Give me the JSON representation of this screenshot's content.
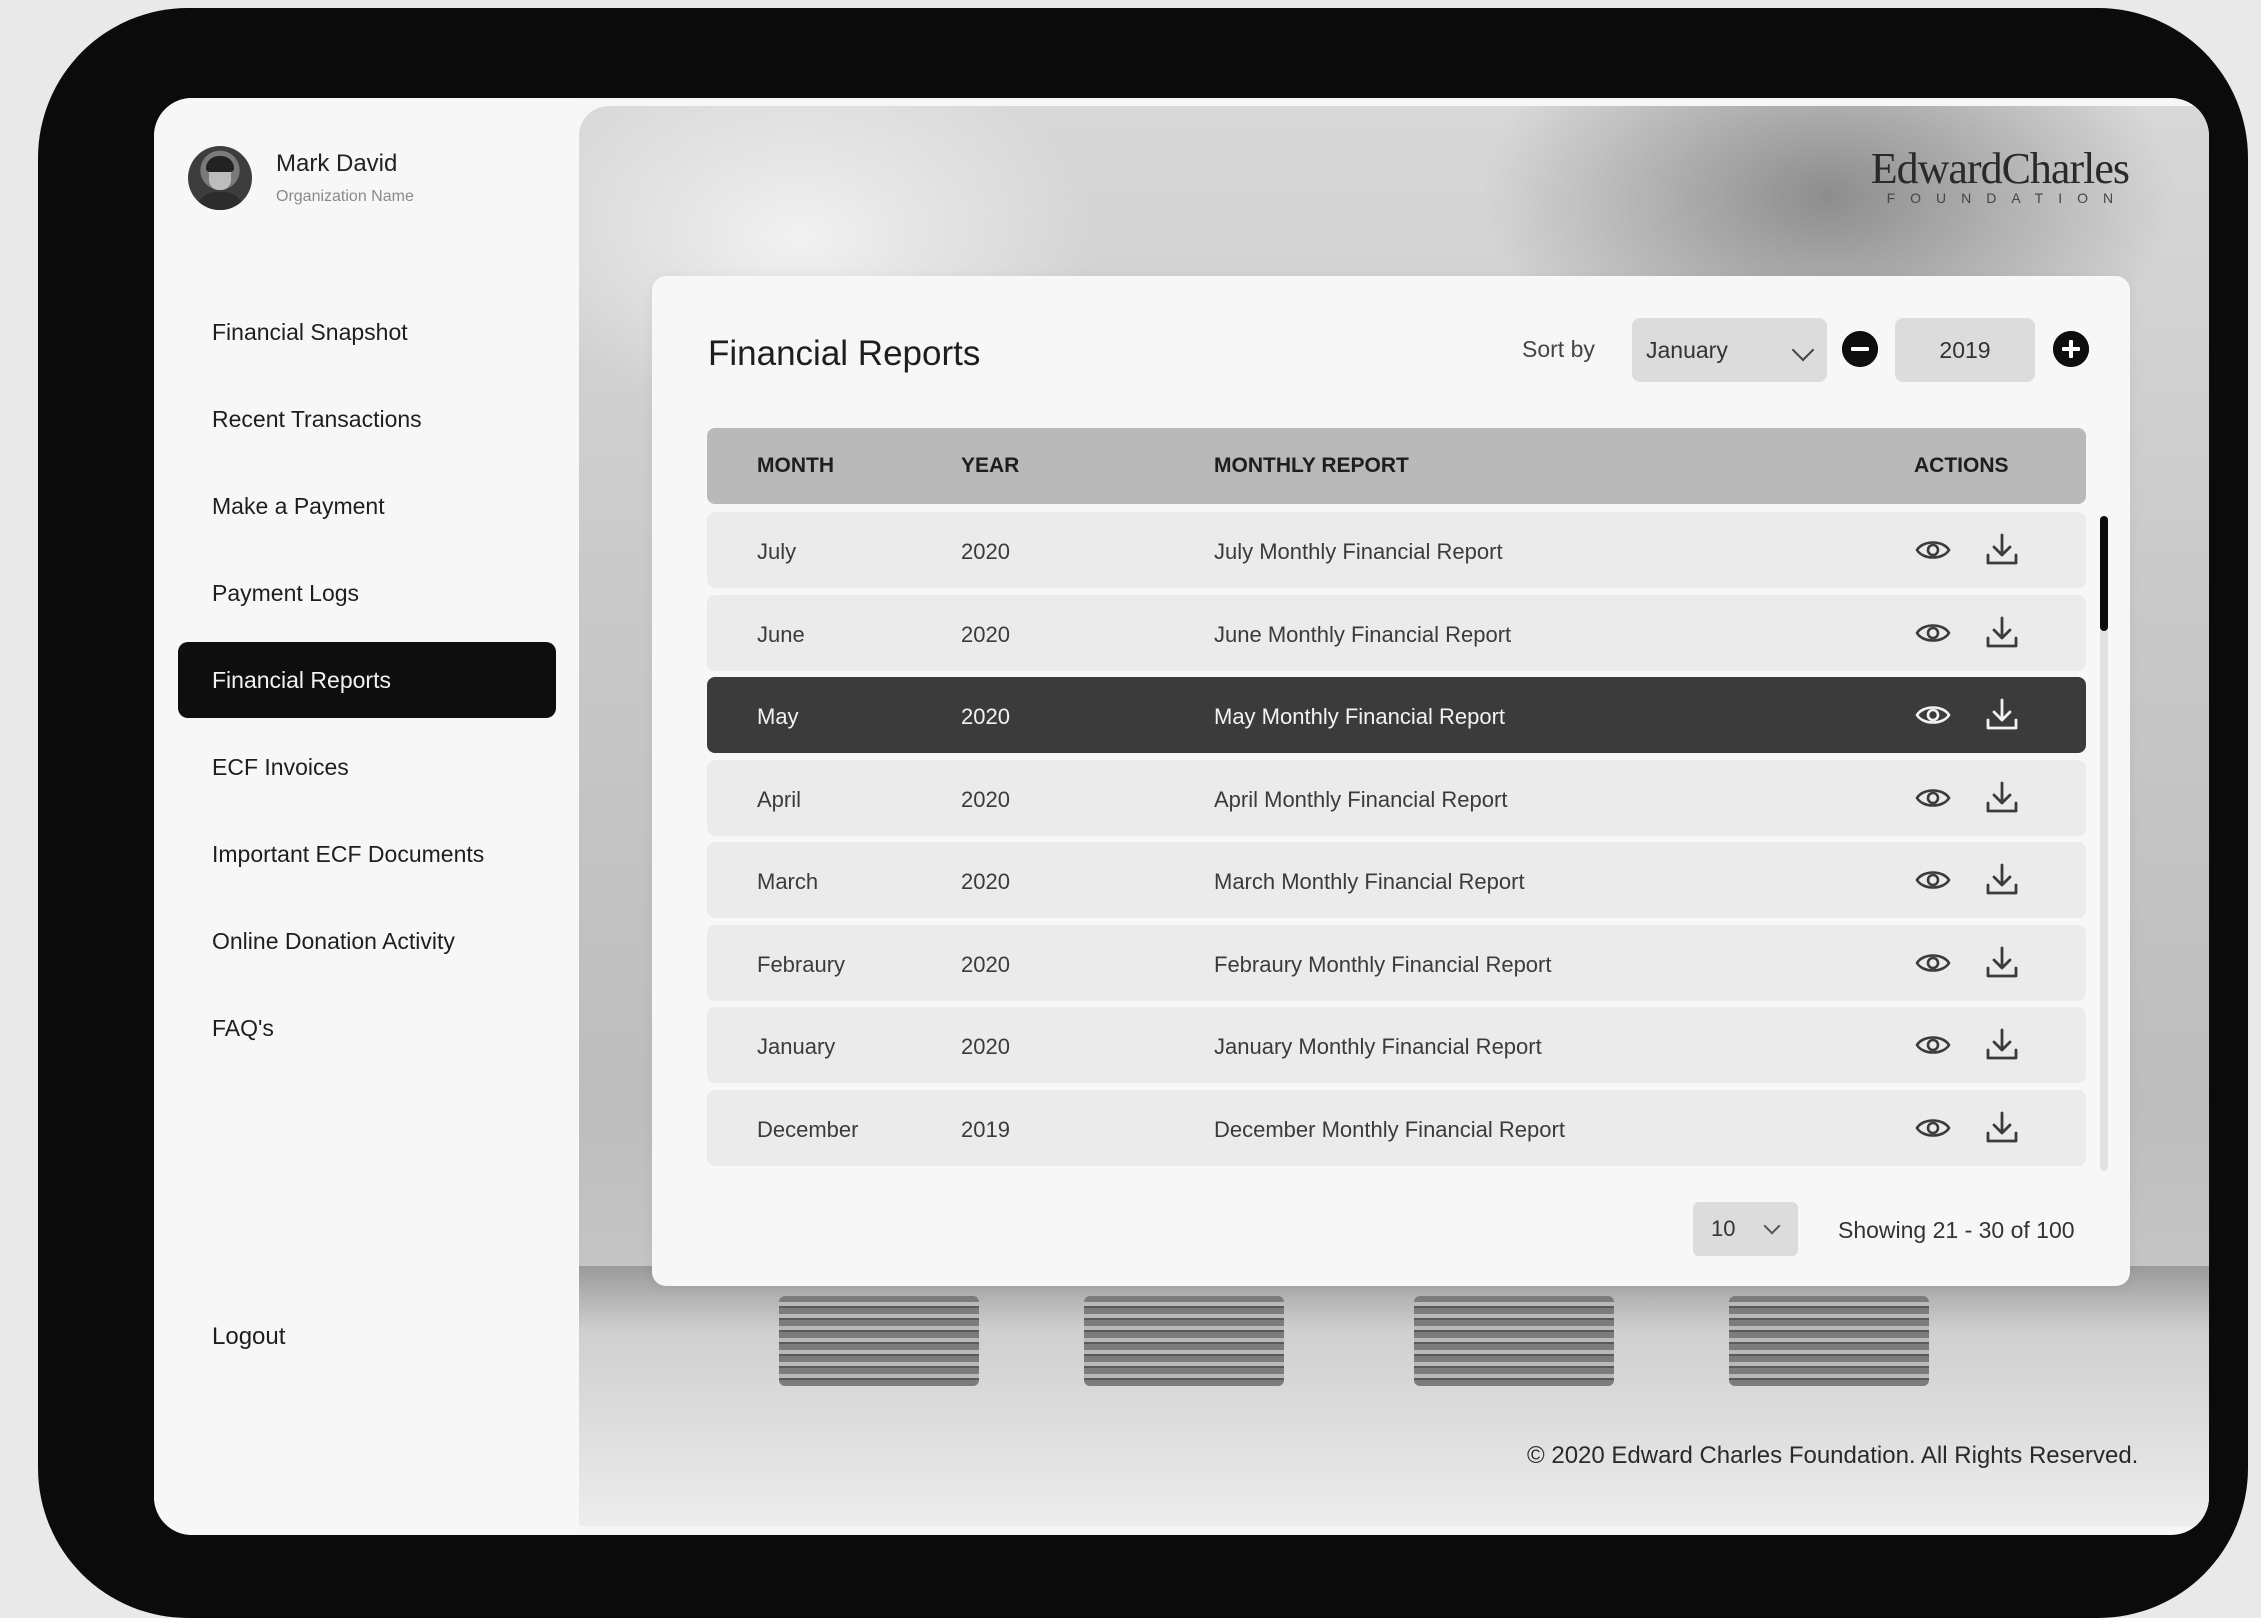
{
  "user": {
    "name": "Mark David",
    "organization": "Organization Name"
  },
  "sidebar": {
    "items": [
      {
        "label": "Financial Snapshot",
        "active": false
      },
      {
        "label": "Recent Transactions",
        "active": false
      },
      {
        "label": "Make a Payment",
        "active": false
      },
      {
        "label": "Payment Logs",
        "active": false
      },
      {
        "label": "Financial Reports",
        "active": true
      },
      {
        "label": "ECF Invoices",
        "active": false
      },
      {
        "label": "Important ECF Documents",
        "active": false
      },
      {
        "label": "Online Donation Activity",
        "active": false
      },
      {
        "label": "FAQ's",
        "active": false
      }
    ],
    "logout_label": "Logout"
  },
  "brand": {
    "name": "EdwardCharles",
    "sub": "FOUNDATION"
  },
  "page": {
    "title": "Financial Reports",
    "sort_label": "Sort by",
    "sort_month": "January",
    "sort_year": "2019",
    "minus_icon": "minus-circle-icon",
    "plus_icon": "plus-circle-icon"
  },
  "table": {
    "headers": {
      "month": "MONTH",
      "year": "YEAR",
      "report": "MONTHLY REPORT",
      "actions": "ACTIONS"
    },
    "rows": [
      {
        "month": "July",
        "year": "2020",
        "report": "July Monthly Financial Report",
        "selected": false
      },
      {
        "month": "June",
        "year": "2020",
        "report": "June Monthly Financial Report",
        "selected": false
      },
      {
        "month": "May",
        "year": "2020",
        "report": "May Monthly Financial Report",
        "selected": true
      },
      {
        "month": "April",
        "year": "2020",
        "report": "April Monthly Financial Report",
        "selected": false
      },
      {
        "month": "March",
        "year": "2020",
        "report": "March Monthly Financial Report",
        "selected": false
      },
      {
        "month": "Febraury",
        "year": "2020",
        "report": "Febraury Monthly Financial Report",
        "selected": false
      },
      {
        "month": "January",
        "year": "2020",
        "report": "January Monthly Financial Report",
        "selected": false
      },
      {
        "month": "December",
        "year": "2019",
        "report": "December Monthly Financial Report",
        "selected": false
      }
    ],
    "action_icons": [
      "eye-icon",
      "download-icon"
    ]
  },
  "pagination": {
    "page_size": "10",
    "showing": "Showing 21 - 30 of 100"
  },
  "footer": {
    "copyright": "© 2020 Edward Charles Foundation. All Rights Reserved."
  },
  "colors": {
    "active_nav": "#0e0e0e",
    "selected_row": "#3b3b3b",
    "header_row": "#b9b9b9"
  }
}
